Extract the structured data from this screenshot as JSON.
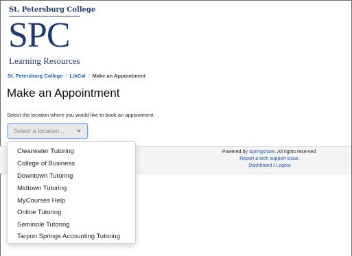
{
  "logo": {
    "org_name": "St. Petersburg College",
    "abbrev": "SPC",
    "subtitle": "Learning Resources",
    "color": "#1f3a73"
  },
  "breadcrumb": {
    "items": [
      "St. Petersburg College",
      "LibCal"
    ],
    "separator": "/",
    "current": "Make an Appointment"
  },
  "page": {
    "title": "Make an Appointment",
    "description": "Select the location where you would like to book an appointment."
  },
  "location_select": {
    "placeholder": "Select a location..."
  },
  "location_options": [
    "Clearwater Tutoring",
    "College of Business",
    "Downtown Tutoring",
    "Midtown Tutoring",
    "MyCourses Help",
    "Online Tutoring",
    "Seminole Tutoring",
    "Tarpon Springs Accounting Tutoring"
  ],
  "footer": {
    "powered_by": "Powered by",
    "springshare": "Springshare",
    "rights": ". All rights reserved.",
    "report_issue": "Report a tech support issue.",
    "dashboard": "Dashboard",
    "divider": "/",
    "logout": "Logout"
  },
  "colors": {
    "link": "#1a5bb8",
    "focus_border": "#6aa3e8"
  }
}
